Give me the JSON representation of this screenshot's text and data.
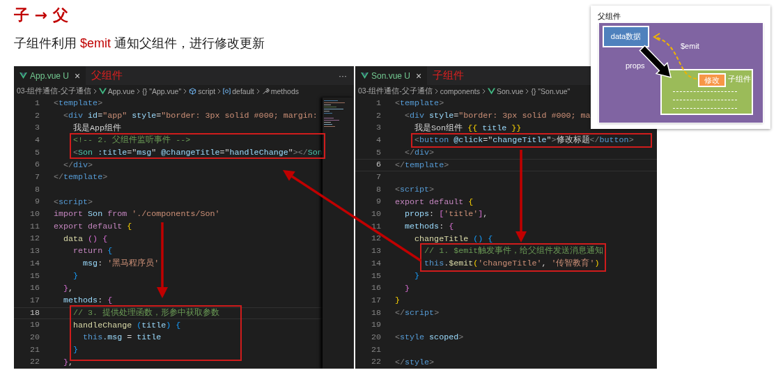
{
  "title": "子 → 父",
  "subtitle": [
    {
      "text": "子组件利用 ",
      "highlight": false
    },
    {
      "text": "$emit",
      "highlight": true
    },
    {
      "text": " 通知父组件，进行修改更新",
      "highlight": false
    }
  ],
  "editors": [
    {
      "tab": {
        "label": "App.vue",
        "badge": "U",
        "close": "×",
        "selected": true
      },
      "annotation": "父组件",
      "more": "···",
      "minimap": true,
      "breadcrumbs": [
        {
          "text": "03-组件通信-父子通信"
        },
        {
          "text": "App.vue",
          "kind": "vue"
        },
        {
          "text": "{} \"App.vue\""
        },
        {
          "text": "script",
          "kind": "cube"
        },
        {
          "text": "default",
          "kind": "variable"
        },
        {
          "text": "methods",
          "kind": "wrench"
        }
      ],
      "lines": [
        {
          "number": "1",
          "current": false,
          "tokens": [
            {
              "text": "<",
              "kind": "p"
            },
            {
              "text": "template",
              "kind": "tag"
            },
            {
              "text": ">",
              "kind": "p"
            }
          ]
        },
        {
          "number": "2",
          "current": false,
          "tokens": [
            {
              "text": "  <",
              "kind": "p"
            },
            {
              "text": "div",
              "kind": "tag"
            },
            {
              "text": " id",
              "kind": "attr"
            },
            {
              "text": "=",
              "kind": "tx"
            },
            {
              "text": "\"app\"",
              "kind": "str"
            },
            {
              "text": " style",
              "kind": "attr"
            },
            {
              "text": "=",
              "kind": "tx"
            },
            {
              "text": "\"border: 3px solid #000; margin:",
              "kind": "str"
            }
          ]
        },
        {
          "number": "3",
          "current": false,
          "tokens": [
            {
              "text": "    我是App组件",
              "kind": "tx"
            }
          ]
        },
        {
          "number": "4",
          "current": false,
          "tokens": [
            {
              "text": "    <!-- 2. 父组件监听事件 -->",
              "kind": "cm"
            }
          ]
        },
        {
          "number": "5",
          "current": false,
          "tokens": [
            {
              "text": "    <",
              "kind": "p"
            },
            {
              "text": "Son",
              "kind": "comp"
            },
            {
              "text": " :title",
              "kind": "attr"
            },
            {
              "text": "=\"",
              "kind": "tx"
            },
            {
              "text": "msg",
              "kind": "var"
            },
            {
              "text": "\"",
              "kind": "tx"
            },
            {
              "text": " @changeTitle",
              "kind": "attr"
            },
            {
              "text": "=\"",
              "kind": "tx"
            },
            {
              "text": "handleChange",
              "kind": "var"
            },
            {
              "text": "\"",
              "kind": "tx"
            },
            {
              "text": "></",
              "kind": "p"
            },
            {
              "text": "Son",
              "kind": "comp"
            }
          ]
        },
        {
          "number": "6",
          "current": false,
          "tokens": [
            {
              "text": "  </",
              "kind": "p"
            },
            {
              "text": "div",
              "kind": "tag"
            },
            {
              "text": ">",
              "kind": "p"
            }
          ]
        },
        {
          "number": "7",
          "current": false,
          "tokens": [
            {
              "text": "</",
              "kind": "p"
            },
            {
              "text": "template",
              "kind": "tag"
            },
            {
              "text": ">",
              "kind": "p"
            }
          ]
        },
        {
          "number": "8",
          "current": false
        },
        {
          "number": "9",
          "current": false,
          "tokens": [
            {
              "text": "<",
              "kind": "p"
            },
            {
              "text": "script",
              "kind": "tag"
            },
            {
              "text": ">",
              "kind": "p"
            }
          ]
        },
        {
          "number": "10",
          "current": false,
          "tokens": [
            {
              "text": "import",
              "kind": "kw"
            },
            {
              "text": " Son ",
              "kind": "var"
            },
            {
              "text": "from",
              "kind": "kw"
            },
            {
              "text": " './components/Son'",
              "kind": "str"
            }
          ]
        },
        {
          "number": "11",
          "current": false,
          "tokens": [
            {
              "text": "export default ",
              "kind": "kw"
            },
            {
              "text": "{",
              "kind": "b1"
            }
          ]
        },
        {
          "number": "12",
          "current": false,
          "tokens": [
            {
              "text": "  data",
              "kind": "fn"
            },
            {
              "text": " () {",
              "kind": "b2"
            }
          ]
        },
        {
          "number": "13",
          "current": false,
          "tokens": [
            {
              "text": "    return",
              "kind": "kw"
            },
            {
              "text": " {",
              "kind": "b3"
            }
          ]
        },
        {
          "number": "14",
          "current": false,
          "tokens": [
            {
              "text": "      msg",
              "kind": "var"
            },
            {
              "text": ": ",
              "kind": "tx"
            },
            {
              "text": "'黑马程序员'",
              "kind": "str"
            }
          ]
        },
        {
          "number": "15",
          "current": false,
          "tokens": [
            {
              "text": "    }",
              "kind": "b3"
            }
          ]
        },
        {
          "number": "16",
          "current": false,
          "tokens": [
            {
              "text": "  }",
              "kind": "b2"
            },
            {
              "text": ",",
              "kind": "tx"
            }
          ]
        },
        {
          "number": "17",
          "current": false,
          "tokens": [
            {
              "text": "  methods",
              "kind": "var"
            },
            {
              "text": ": ",
              "kind": "tx"
            },
            {
              "text": "{",
              "kind": "b2"
            }
          ]
        },
        {
          "number": "18",
          "current": true,
          "tokens": [
            {
              "text": "    // 3. 提供处理函数，形参中获取参数",
              "kind": "cm"
            }
          ]
        },
        {
          "number": "19",
          "current": false,
          "tokens": [
            {
              "text": "    handleChange",
              "kind": "fn"
            },
            {
              "text": " (",
              "kind": "b3"
            },
            {
              "text": "title",
              "kind": "var"
            },
            {
              "text": ")",
              "kind": "b3"
            },
            {
              "text": " {",
              "kind": "b3"
            }
          ]
        },
        {
          "number": "20",
          "current": false,
          "tokens": [
            {
              "text": "      this",
              "kind": "this"
            },
            {
              "text": ".msg",
              "kind": "var"
            },
            {
              "text": " = ",
              "kind": "tx"
            },
            {
              "text": "title",
              "kind": "var"
            }
          ]
        },
        {
          "number": "21",
          "current": false,
          "tokens": [
            {
              "text": "    }",
              "kind": "b3"
            }
          ]
        },
        {
          "number": "22",
          "current": false,
          "tokens": [
            {
              "text": "  }",
              "kind": "b2"
            },
            {
              "text": ",",
              "kind": "tx"
            }
          ]
        }
      ]
    },
    {
      "tab": {
        "label": "Son.vue",
        "badge": "U",
        "close": "×",
        "selected": true
      },
      "annotation": "子组件",
      "minimap": false,
      "breadcrumbs": [
        {
          "text": "03-组件通信-父子通信"
        },
        {
          "text": "components"
        },
        {
          "text": "Son.vue",
          "kind": "vue"
        },
        {
          "text": "{} \"Son.vue\""
        }
      ],
      "lines": [
        {
          "number": "1",
          "current": false,
          "tokens": [
            {
              "text": "<",
              "kind": "p"
            },
            {
              "text": "template",
              "kind": "tag"
            },
            {
              "text": ">",
              "kind": "p"
            }
          ]
        },
        {
          "number": "2",
          "current": false,
          "tokens": [
            {
              "text": "  <",
              "kind": "p"
            },
            {
              "text": "div",
              "kind": "tag"
            },
            {
              "text": " style",
              "kind": "attr"
            },
            {
              "text": "=",
              "kind": "tx"
            },
            {
              "text": "\"border: 3px solid #000; ma",
              "kind": "str"
            }
          ]
        },
        {
          "number": "3",
          "current": false,
          "tokens": [
            {
              "text": "    我是Son组件 ",
              "kind": "tx"
            },
            {
              "text": "{{",
              "kind": "b1"
            },
            {
              "text": " title ",
              "kind": "var"
            },
            {
              "text": "}}",
              "kind": "b1"
            }
          ]
        },
        {
          "number": "4",
          "current": false,
          "tokens": [
            {
              "text": "    <",
              "kind": "p"
            },
            {
              "text": "button",
              "kind": "tag"
            },
            {
              "text": " @click",
              "kind": "attr"
            },
            {
              "text": "=\"",
              "kind": "tx"
            },
            {
              "text": "changeTitle",
              "kind": "var"
            },
            {
              "text": "\"",
              "kind": "tx"
            },
            {
              "text": ">",
              "kind": "p"
            },
            {
              "text": "修改标题",
              "kind": "tx"
            },
            {
              "text": "</",
              "kind": "p"
            },
            {
              "text": "button",
              "kind": "tag"
            },
            {
              "text": ">",
              "kind": "p"
            }
          ]
        },
        {
          "number": "5",
          "current": false,
          "tokens": [
            {
              "text": "  </",
              "kind": "p"
            },
            {
              "text": "div",
              "kind": "tag"
            },
            {
              "text": ">",
              "kind": "p"
            }
          ]
        },
        {
          "number": "6",
          "current": true,
          "tokens": [
            {
              "text": "</",
              "kind": "p"
            },
            {
              "text": "template",
              "kind": "tag"
            },
            {
              "text": ">",
              "kind": "p"
            }
          ]
        },
        {
          "number": "7",
          "current": false
        },
        {
          "number": "8",
          "current": false,
          "tokens": [
            {
              "text": "<",
              "kind": "p"
            },
            {
              "text": "script",
              "kind": "tag"
            },
            {
              "text": ">",
              "kind": "p"
            }
          ]
        },
        {
          "number": "9",
          "current": false,
          "tokens": [
            {
              "text": "export default ",
              "kind": "kw"
            },
            {
              "text": "{",
              "kind": "b1"
            }
          ]
        },
        {
          "number": "10",
          "current": false,
          "tokens": [
            {
              "text": "  props",
              "kind": "var"
            },
            {
              "text": ": ",
              "kind": "tx"
            },
            {
              "text": "[",
              "kind": "b2"
            },
            {
              "text": "'title'",
              "kind": "str"
            },
            {
              "text": "]",
              "kind": "b2"
            },
            {
              "text": ",",
              "kind": "tx"
            }
          ]
        },
        {
          "number": "11",
          "current": false,
          "tokens": [
            {
              "text": "  methods",
              "kind": "var"
            },
            {
              "text": ": ",
              "kind": "tx"
            },
            {
              "text": "{",
              "kind": "b2"
            }
          ]
        },
        {
          "number": "12",
          "current": false,
          "tokens": [
            {
              "text": "    changeTitle",
              "kind": "fn"
            },
            {
              "text": " () {",
              "kind": "b3"
            }
          ]
        },
        {
          "number": "13",
          "current": false,
          "tokens": [
            {
              "text": "      // 1. $emit触发事件，给父组件发送消息通知",
              "kind": "cm"
            }
          ]
        },
        {
          "number": "14",
          "current": false,
          "tokens": [
            {
              "text": "      this",
              "kind": "this"
            },
            {
              "text": ".",
              "kind": "tx"
            },
            {
              "text": "$emit",
              "kind": "fn"
            },
            {
              "text": "(",
              "kind": "b1"
            },
            {
              "text": "'changeTitle'",
              "kind": "str"
            },
            {
              "text": ", ",
              "kind": "tx"
            },
            {
              "text": "'传智教育'",
              "kind": "str"
            },
            {
              "text": ")",
              "kind": "b1"
            }
          ]
        },
        {
          "number": "15",
          "current": false,
          "tokens": [
            {
              "text": "    }",
              "kind": "b3"
            }
          ]
        },
        {
          "number": "16",
          "current": false,
          "tokens": [
            {
              "text": "  }",
              "kind": "b2"
            }
          ]
        },
        {
          "number": "17",
          "current": false,
          "tokens": [
            {
              "text": "}",
              "kind": "b1"
            }
          ]
        },
        {
          "number": "18",
          "current": false,
          "tokens": [
            {
              "text": "</",
              "kind": "p"
            },
            {
              "text": "script",
              "kind": "tag"
            },
            {
              "text": ">",
              "kind": "p"
            }
          ]
        },
        {
          "number": "19",
          "current": false
        },
        {
          "number": "20",
          "current": false,
          "tokens": [
            {
              "text": "<",
              "kind": "p"
            },
            {
              "text": "style",
              "kind": "tag"
            },
            {
              "text": " scoped",
              "kind": "attr"
            },
            {
              "text": ">",
              "kind": "p"
            }
          ]
        },
        {
          "number": "21",
          "current": false
        },
        {
          "number": "22",
          "current": false,
          "tokens": [
            {
              "text": "</",
              "kind": "p"
            },
            {
              "text": "style",
              "kind": "tag"
            },
            {
              "text": ">",
              "kind": "p"
            }
          ]
        }
      ]
    }
  ],
  "diagram": {
    "title": "父组件",
    "data_box": "data数据",
    "props_label": "props",
    "emit_label": "$emit",
    "button": "修改",
    "child_label": "子组件"
  }
}
